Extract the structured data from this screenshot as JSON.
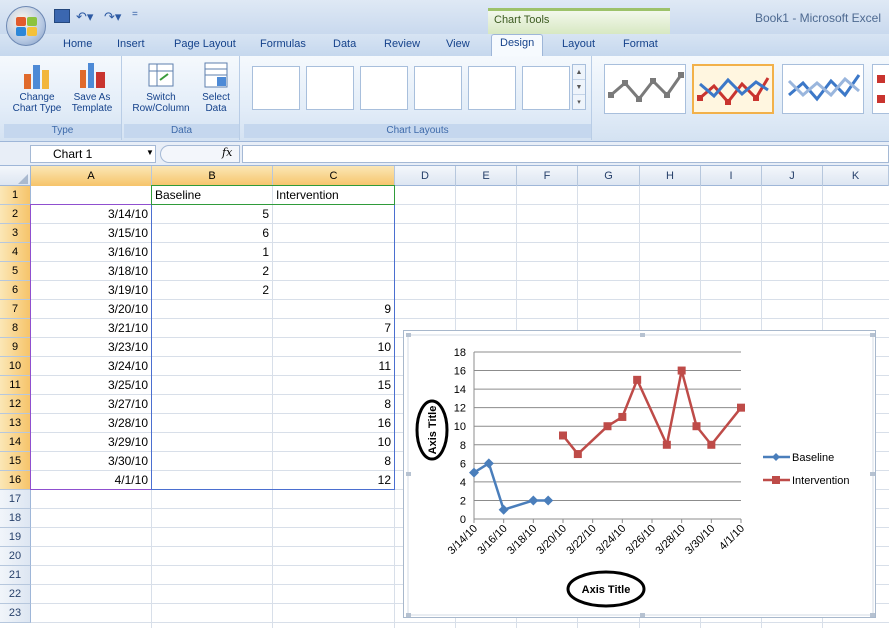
{
  "title_bar": {
    "app_title": "Book1 - Microsoft Excel",
    "contextual_label": "Chart Tools"
  },
  "tabs": [
    {
      "label": "Home"
    },
    {
      "label": "Insert"
    },
    {
      "label": "Page Layout"
    },
    {
      "label": "Formulas"
    },
    {
      "label": "Data"
    },
    {
      "label": "Review"
    },
    {
      "label": "View"
    },
    {
      "label": "Design"
    },
    {
      "label": "Layout"
    },
    {
      "label": "Format"
    }
  ],
  "ribbon": {
    "type_group": {
      "label": "Type",
      "change_chart_type": "Change Chart Type",
      "save_as_template": "Save As Template"
    },
    "data_group": {
      "label": "Data",
      "switch_row_column": "Switch Row/Column",
      "select_data": "Select Data"
    },
    "layouts_group": {
      "label": "Chart Layouts"
    }
  },
  "formula_bar": {
    "name_box": "Chart 1",
    "fx": "fx",
    "formula": ""
  },
  "columns": [
    "A",
    "B",
    "C",
    "D",
    "E",
    "F",
    "G",
    "H",
    "I",
    "J",
    "K"
  ],
  "rows": [
    "1",
    "2",
    "3",
    "4",
    "5",
    "6",
    "7",
    "8",
    "9",
    "10",
    "11",
    "12",
    "13",
    "14",
    "15",
    "16",
    "17",
    "18",
    "19",
    "20",
    "21",
    "22",
    "23"
  ],
  "sheet": {
    "header": {
      "b": "Baseline",
      "c": "Intervention"
    },
    "data": [
      {
        "a": "3/14/10",
        "b": "5",
        "c": ""
      },
      {
        "a": "3/15/10",
        "b": "6",
        "c": ""
      },
      {
        "a": "3/16/10",
        "b": "1",
        "c": ""
      },
      {
        "a": "3/18/10",
        "b": "2",
        "c": ""
      },
      {
        "a": "3/19/10",
        "b": "2",
        "c": ""
      },
      {
        "a": "3/20/10",
        "b": "",
        "c": "9"
      },
      {
        "a": "3/21/10",
        "b": "",
        "c": "7"
      },
      {
        "a": "3/23/10",
        "b": "",
        "c": "10"
      },
      {
        "a": "3/24/10",
        "b": "",
        "c": "11"
      },
      {
        "a": "3/25/10",
        "b": "",
        "c": "15"
      },
      {
        "a": "3/27/10",
        "b": "",
        "c": "8"
      },
      {
        "a": "3/28/10",
        "b": "",
        "c": "16"
      },
      {
        "a": "3/29/10",
        "b": "",
        "c": "10"
      },
      {
        "a": "3/30/10",
        "b": "",
        "c": "8"
      },
      {
        "a": "4/1/10",
        "b": "",
        "c": "12"
      }
    ]
  },
  "colors": {
    "baseline": "#4a7ebb",
    "intervention": "#be4b48",
    "accent_selection": "#f2b14a"
  },
  "chart_data": {
    "type": "line",
    "xlabel": "Axis Title",
    "ylabel": "Axis Title",
    "ylim": [
      0,
      18
    ],
    "yticks": [
      "0",
      "2",
      "4",
      "6",
      "8",
      "10",
      "12",
      "14",
      "16",
      "18"
    ],
    "xticks": [
      "3/14/10",
      "3/16/10",
      "3/18/10",
      "3/20/10",
      "3/22/10",
      "3/24/10",
      "3/26/10",
      "3/28/10",
      "3/30/10",
      "4/1/10"
    ],
    "x_range": [
      "2010-03-14",
      "2010-04-01"
    ],
    "grid": true,
    "legend": "right",
    "series": [
      {
        "name": "Baseline",
        "color": "#4a7ebb",
        "marker": "diamond",
        "x": [
          "2010-03-14",
          "2010-03-15",
          "2010-03-16",
          "2010-03-18",
          "2010-03-19"
        ],
        "values": [
          5,
          6,
          1,
          2,
          2
        ]
      },
      {
        "name": "Intervention",
        "color": "#be4b48",
        "marker": "square",
        "x": [
          "2010-03-20",
          "2010-03-21",
          "2010-03-23",
          "2010-03-24",
          "2010-03-25",
          "2010-03-27",
          "2010-03-28",
          "2010-03-29",
          "2010-03-30",
          "2010-04-01"
        ],
        "values": [
          9,
          7,
          10,
          11,
          15,
          8,
          16,
          10,
          8,
          12
        ]
      }
    ]
  }
}
